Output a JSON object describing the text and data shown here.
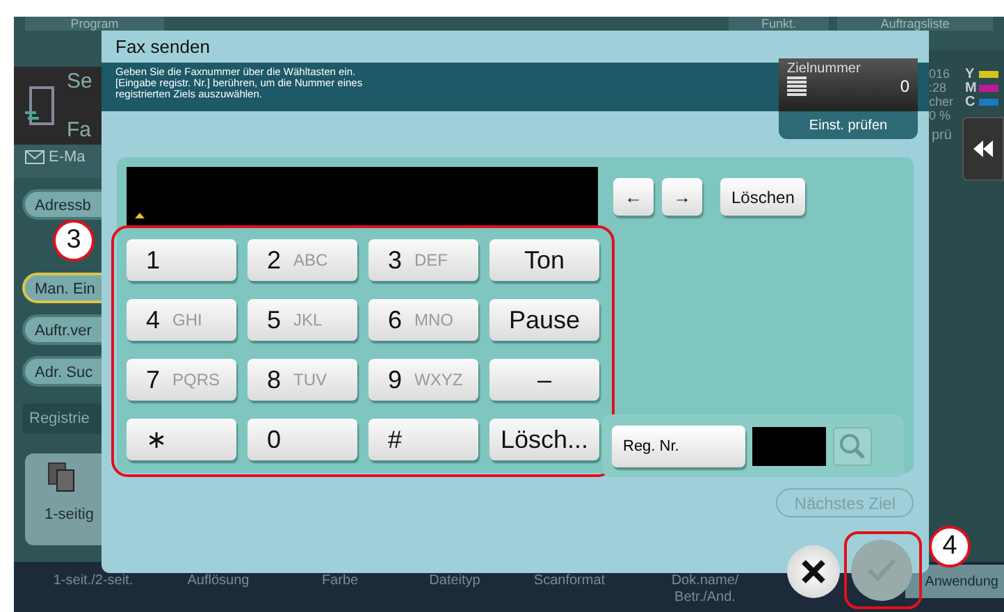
{
  "background": {
    "top_bar": {
      "program_button": "Program",
      "function_button": "Funkt.",
      "job_list_button": "Auftragsliste"
    },
    "header": [
      "Se",
      "Fa"
    ],
    "email_tab": "E-Ma",
    "side_buttons": [
      {
        "label": "Adressb",
        "selected": false
      },
      {
        "label": "Man. Ein",
        "selected": true
      },
      {
        "label": "Auftr.ver",
        "selected": false
      },
      {
        "label": "Adr. Suc",
        "selected": false
      }
    ],
    "register_button": "Registrie",
    "tile": "1-seitig",
    "bottom_tabs": [
      "1-seit./2-seit.",
      "Auflösung",
      "Farbe",
      "Dateityp",
      "Scanformat",
      "Dok.name/\nBetr./And."
    ],
    "application_button": "Anwendung",
    "status": [
      "016",
      ":28",
      "cher",
      "0 %"
    ],
    "toner": [
      {
        "label": "Y",
        "color": "#d8c21c"
      },
      {
        "label": "M",
        "color": "#c0179a"
      },
      {
        "label": "C",
        "color": "#1b7ac4"
      }
    ],
    "side_link": "prü"
  },
  "dialog": {
    "title": "Fax senden",
    "instruction": "Geben Sie die Faxnummer über die Wähltasten ein.\n[Eingabe registr. Nr.] berühren, um die Nummer eines\nregistrierten Ziels auszuwählen.",
    "destination_count": {
      "label": "Zielnummer",
      "value": "0"
    },
    "check_button": "Einst. prüfen",
    "nav_buttons": [
      "←",
      "→"
    ],
    "clear_button": "Löschen",
    "keypad": [
      {
        "kind": "digit",
        "main": "1"
      },
      {
        "kind": "digit",
        "main": "2",
        "sub": "ABC"
      },
      {
        "kind": "digit",
        "main": "3",
        "sub": "DEF"
      },
      {
        "kind": "function",
        "main": "Ton"
      },
      {
        "kind": "digit",
        "main": "4",
        "sub": "GHI"
      },
      {
        "kind": "digit",
        "main": "5",
        "sub": "JKL"
      },
      {
        "kind": "digit",
        "main": "6",
        "sub": "MNO"
      },
      {
        "kind": "function",
        "main": "Pause"
      },
      {
        "kind": "digit",
        "main": "7",
        "sub": "PQRS"
      },
      {
        "kind": "digit",
        "main": "8",
        "sub": "TUV"
      },
      {
        "kind": "digit",
        "main": "9",
        "sub": "WXYZ"
      },
      {
        "kind": "function",
        "main": "–"
      },
      {
        "kind": "digit",
        "main": "∗"
      },
      {
        "kind": "digit",
        "main": "0"
      },
      {
        "kind": "digit",
        "main": "#"
      },
      {
        "kind": "function",
        "main": "Lösch..."
      }
    ],
    "reg_button": "Reg. Nr.",
    "next_button": {
      "label": "Nächstes Ziel",
      "disabled": true
    },
    "ok_button": {
      "disabled": true
    }
  },
  "callouts": [
    "3",
    "4"
  ]
}
